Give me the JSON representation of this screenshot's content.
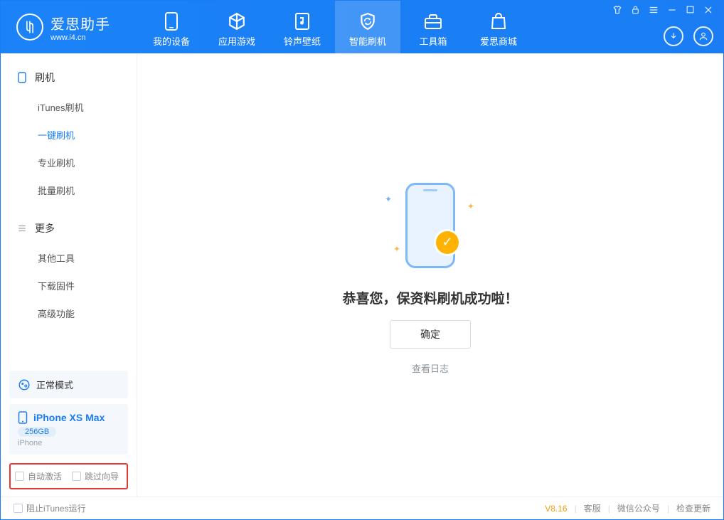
{
  "app": {
    "title": "爱思助手",
    "subtitle": "www.i4.cn"
  },
  "nav": {
    "items": [
      {
        "label": "我的设备"
      },
      {
        "label": "应用游戏"
      },
      {
        "label": "铃声壁纸"
      },
      {
        "label": "智能刷机"
      },
      {
        "label": "工具箱"
      },
      {
        "label": "爱思商城"
      }
    ]
  },
  "sidebar": {
    "section1": {
      "title": "刷机"
    },
    "items1": [
      {
        "label": "iTunes刷机"
      },
      {
        "label": "一键刷机"
      },
      {
        "label": "专业刷机"
      },
      {
        "label": "批量刷机"
      }
    ],
    "section2": {
      "title": "更多"
    },
    "items2": [
      {
        "label": "其他工具"
      },
      {
        "label": "下载固件"
      },
      {
        "label": "高级功能"
      }
    ],
    "mode": {
      "label": "正常模式"
    },
    "device": {
      "name": "iPhone XS Max",
      "storage": "256GB",
      "type": "iPhone"
    },
    "options": {
      "auto_activate": "自动激活",
      "skip_guide": "跳过向导"
    }
  },
  "main": {
    "success_title": "恭喜您，保资料刷机成功啦！",
    "ok_button": "确定",
    "view_log": "查看日志"
  },
  "footer": {
    "block_itunes": "阻止iTunes运行",
    "version": "V8.16",
    "support": "客服",
    "wechat": "微信公众号",
    "update": "检查更新"
  }
}
